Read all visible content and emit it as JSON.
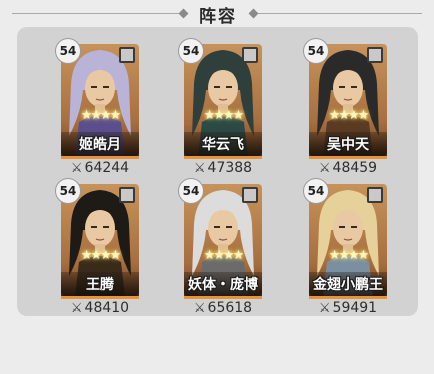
{
  "header": {
    "title": "阵容"
  },
  "heroes": [
    {
      "level": "54",
      "name": "姬皓月",
      "power": "64244",
      "stars": "★★★★",
      "hair": "#b9b3d8",
      "robe": "#5a4f8c"
    },
    {
      "level": "54",
      "name": "华云飞",
      "power": "47388",
      "stars": "★★★★",
      "hair": "#2f3f3c",
      "robe": "#2c4a45"
    },
    {
      "level": "54",
      "name": "吴中天",
      "power": "48459",
      "stars": "★★★★",
      "hair": "#2a2a2a",
      "robe": "#5a3a22"
    },
    {
      "level": "54",
      "name": "王腾",
      "power": "48410",
      "stars": "★★★★",
      "hair": "#1e1a16",
      "robe": "#3a2a1a"
    },
    {
      "level": "54",
      "name": "妖体・庞博",
      "power": "65618",
      "stars": "★★★★",
      "hair": "#dcdcdc",
      "robe": "#6b6b6b"
    },
    {
      "level": "54",
      "name": "金翅小鹏王",
      "power": "59491",
      "stars": "★★★★",
      "hair": "#e7d19a",
      "robe": "#7a8fa0"
    }
  ],
  "icons": {
    "power": "crossed-swords-icon",
    "menu": "grid-menu-icon"
  }
}
